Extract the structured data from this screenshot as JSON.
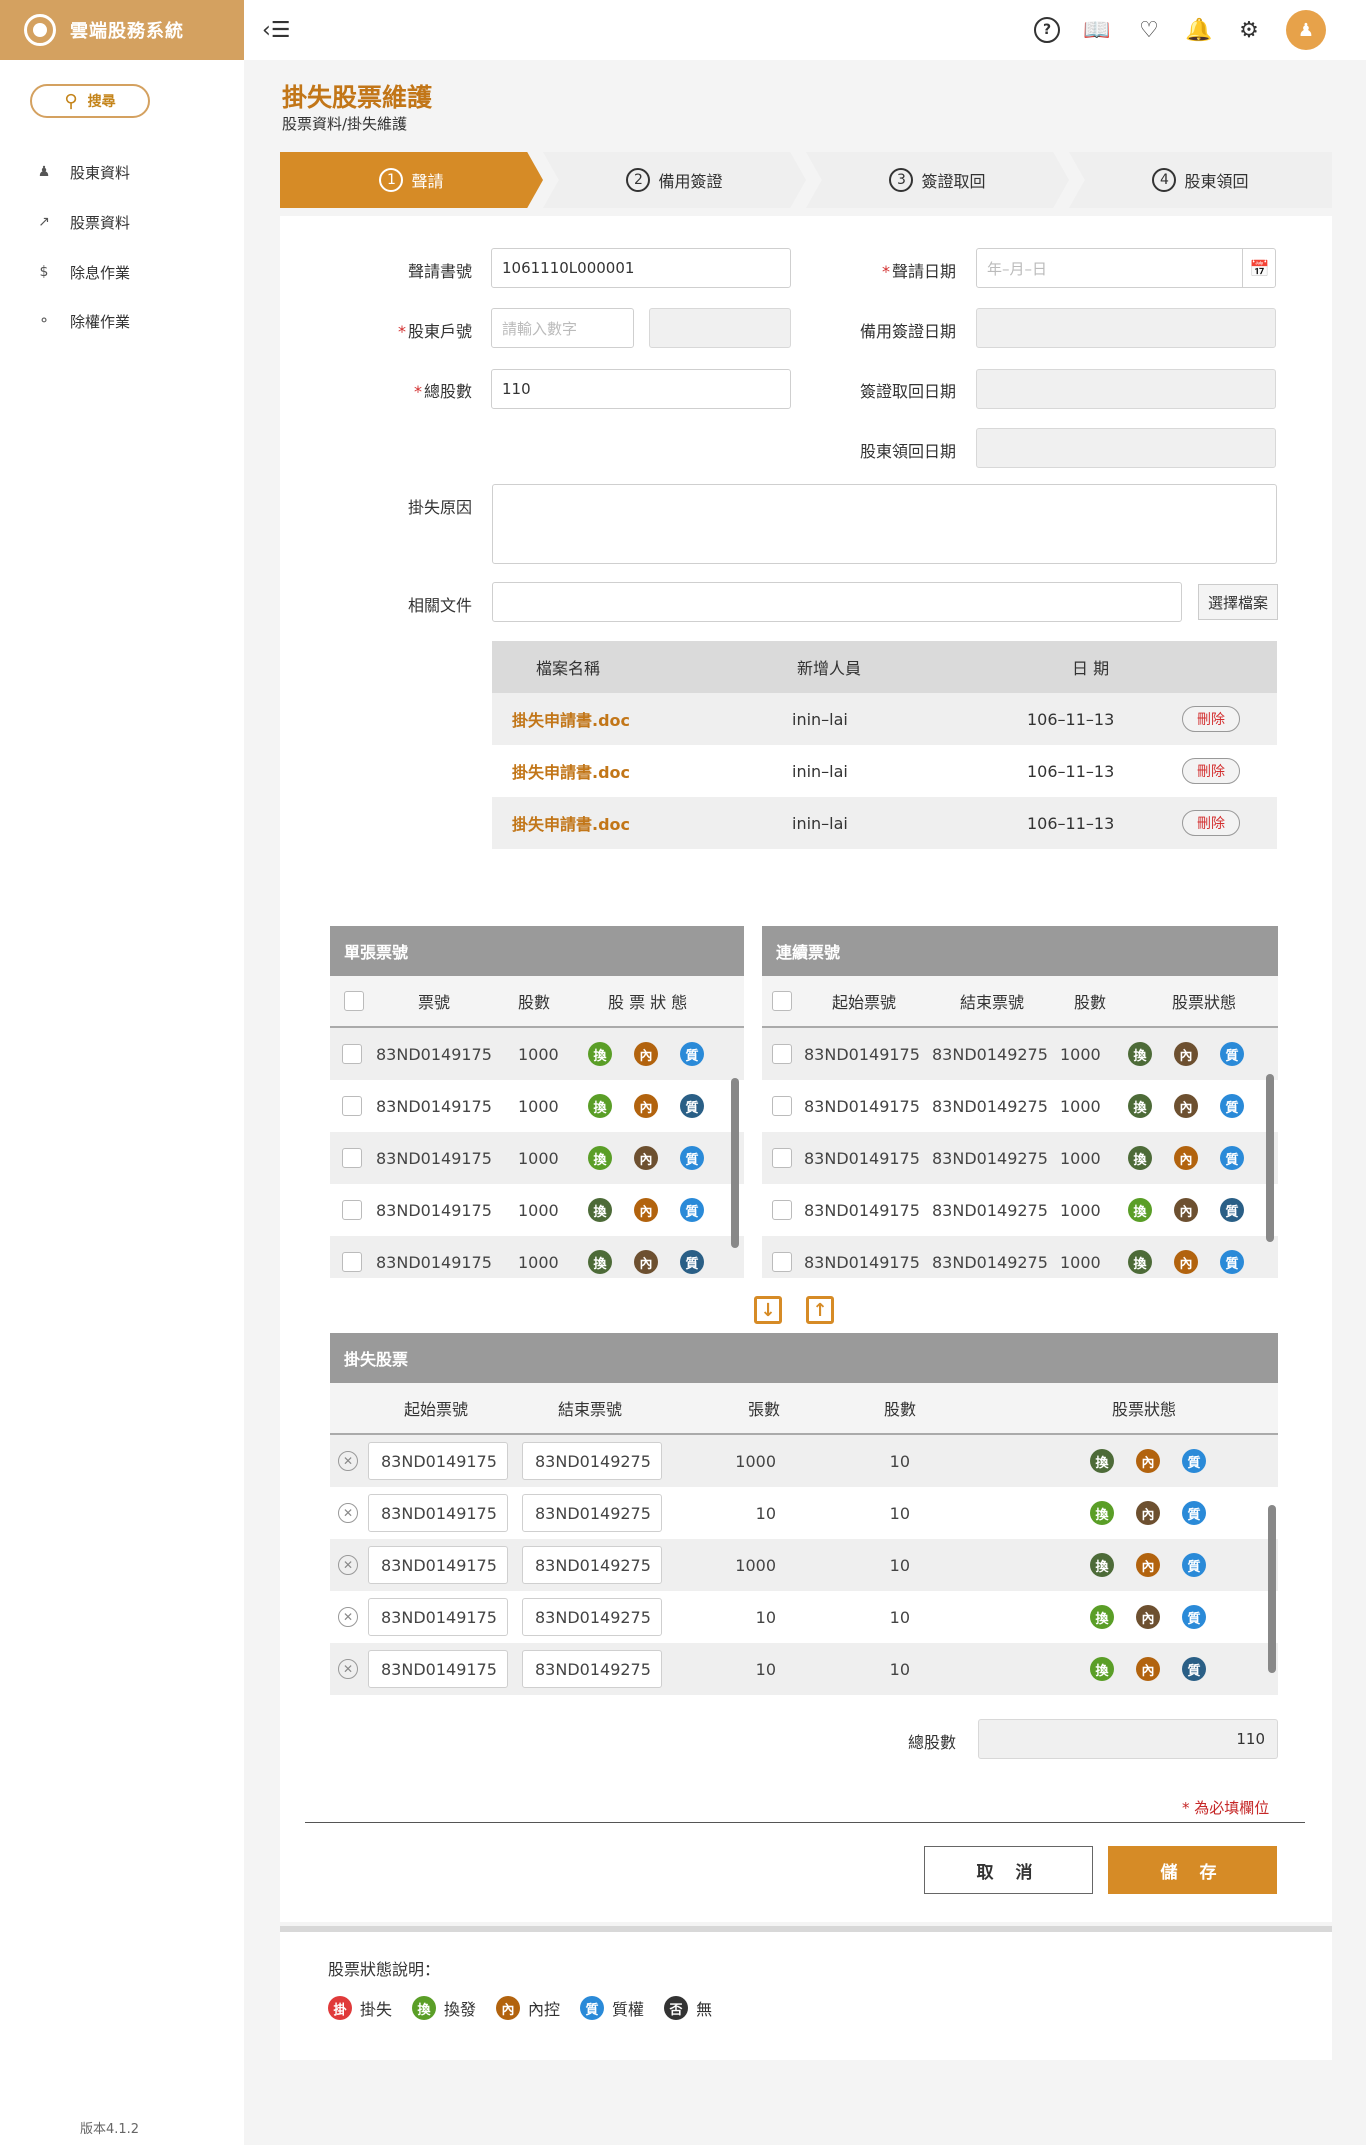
{
  "app": {
    "title": "雲端股務系統",
    "version": "版本4.1.2"
  },
  "sidebar": {
    "search_label": "搜尋",
    "items": [
      {
        "label": "股東資料"
      },
      {
        "label": "股票資料"
      },
      {
        "label": "除息作業"
      },
      {
        "label": "除權作業"
      }
    ]
  },
  "topbar": {
    "icons": [
      "help-icon",
      "book-icon",
      "heart-icon",
      "bell-icon",
      "gear-icon",
      "user-icon"
    ]
  },
  "page": {
    "title": "掛失股票維護",
    "breadcrumb": "股票資料/掛失維護"
  },
  "steps": [
    {
      "num": "1",
      "label": "聲請"
    },
    {
      "num": "2",
      "label": "備用簽證"
    },
    {
      "num": "3",
      "label": "簽證取回"
    },
    {
      "num": "4",
      "label": "股東領回"
    }
  ],
  "form": {
    "req_mark": "*",
    "application_no_label": "聲請書號",
    "application_no_value": "1061110L000001",
    "application_date_label": "聲請日期",
    "application_date_placeholder": "年–月–日",
    "shareholder_no_label": "股東戶號",
    "shareholder_no_placeholder": "請輸入數字",
    "backup_sign_date_label": "備用簽證日期",
    "total_shares_label": "總股數",
    "total_shares_value": "110",
    "sign_return_date_label": "簽證取回日期",
    "holder_return_date_label": "股東領回日期",
    "reason_label": "掛失原因",
    "docs_label": "相關文件",
    "choose_file_label": "選擇檔案"
  },
  "files": {
    "headers": [
      "檔案名稱",
      "新增人員",
      "日 期"
    ],
    "rows": [
      {
        "name": "掛失申請書.doc",
        "user": "inin–lai",
        "date": "106–11–13",
        "action": "刪除"
      },
      {
        "name": "掛失申請書.doc",
        "user": "inin–lai",
        "date": "106–11–13",
        "action": "刪除"
      },
      {
        "name": "掛失申請書.doc",
        "user": "inin–lai",
        "date": "106–11–13",
        "action": "刪除"
      }
    ]
  },
  "single": {
    "title": "單張票號",
    "headers": [
      "票號",
      "股數",
      "股 票 狀 態"
    ],
    "rows": [
      {
        "no": "83ND0149175",
        "shares": "1000",
        "badges": [
          "換",
          "內",
          "質"
        ],
        "styles": [
          "b-green",
          "b-brown",
          "b-blue"
        ]
      },
      {
        "no": "83ND0149175",
        "shares": "1000",
        "badges": [
          "換",
          "內",
          "質"
        ],
        "styles": [
          "b-green",
          "b-brown",
          "b-dblue"
        ]
      },
      {
        "no": "83ND0149175",
        "shares": "1000",
        "badges": [
          "換",
          "內",
          "質"
        ],
        "styles": [
          "b-green",
          "b-dbrown",
          "b-blue"
        ]
      },
      {
        "no": "83ND0149175",
        "shares": "1000",
        "badges": [
          "換",
          "內",
          "質"
        ],
        "styles": [
          "b-dgreen",
          "b-brown",
          "b-blue"
        ]
      },
      {
        "no": "83ND0149175",
        "shares": "1000",
        "badges": [
          "換",
          "內",
          "質"
        ],
        "styles": [
          "b-dgreen",
          "b-dbrown",
          "b-dblue"
        ]
      }
    ]
  },
  "consecutive": {
    "title": "連續票號",
    "headers": [
      "起始票號",
      "結束票號",
      "股數",
      "股票狀態"
    ],
    "rows": [
      {
        "start": "83ND0149175",
        "end": "83ND0149275",
        "shares": "1000",
        "badges": [
          "換",
          "內",
          "質"
        ],
        "styles": [
          "b-dgreen",
          "b-dbrown",
          "b-blue"
        ]
      },
      {
        "start": "83ND0149175",
        "end": "83ND0149275",
        "shares": "1000",
        "badges": [
          "換",
          "內",
          "質"
        ],
        "styles": [
          "b-dgreen",
          "b-dbrown",
          "b-blue"
        ]
      },
      {
        "start": "83ND0149175",
        "end": "83ND0149275",
        "shares": "1000",
        "badges": [
          "換",
          "內",
          "質"
        ],
        "styles": [
          "b-dgreen",
          "b-brown",
          "b-blue"
        ]
      },
      {
        "start": "83ND0149175",
        "end": "83ND0149275",
        "shares": "1000",
        "badges": [
          "換",
          "內",
          "質"
        ],
        "styles": [
          "b-green",
          "b-dbrown",
          "b-dblue"
        ]
      },
      {
        "start": "83ND0149175",
        "end": "83ND0149275",
        "shares": "1000",
        "badges": [
          "換",
          "內",
          "質"
        ],
        "styles": [
          "b-dgreen",
          "b-brown",
          "b-blue"
        ]
      }
    ]
  },
  "lost": {
    "title": "掛失股票",
    "headers": [
      "起始票號",
      "結束票號",
      "張數",
      "股數",
      "股票狀態"
    ],
    "rows": [
      {
        "start": "83ND0149175",
        "end": "83ND0149275",
        "sheets": "1000",
        "shares": "10",
        "badges": [
          "換",
          "內",
          "質"
        ],
        "styles": [
          "b-dgreen",
          "b-brown",
          "b-blue"
        ]
      },
      {
        "start": "83ND0149175",
        "end": "83ND0149275",
        "sheets": "10",
        "shares": "10",
        "badges": [
          "換",
          "內",
          "質"
        ],
        "styles": [
          "b-green",
          "b-dbrown",
          "b-blue"
        ]
      },
      {
        "start": "83ND0149175",
        "end": "83ND0149275",
        "sheets": "1000",
        "shares": "10",
        "badges": [
          "換",
          "內",
          "質"
        ],
        "styles": [
          "b-dgreen",
          "b-brown",
          "b-blue"
        ]
      },
      {
        "start": "83ND0149175",
        "end": "83ND0149275",
        "sheets": "10",
        "shares": "10",
        "badges": [
          "換",
          "內",
          "質"
        ],
        "styles": [
          "b-green",
          "b-dbrown",
          "b-blue"
        ]
      },
      {
        "start": "83ND0149175",
        "end": "83ND0149275",
        "sheets": "10",
        "shares": "10",
        "badges": [
          "換",
          "內",
          "質"
        ],
        "styles": [
          "b-green",
          "b-brown",
          "b-dblue"
        ]
      }
    ],
    "total_label": "總股數",
    "total_value": "110"
  },
  "required_note": "為必填欄位",
  "actions": {
    "cancel": "取 消",
    "save": "儲 存"
  },
  "legend": {
    "title": "股票狀態說明：",
    "items": [
      {
        "glyph": "掛",
        "label": "掛失",
        "style": "b-red"
      },
      {
        "glyph": "換",
        "label": "換發",
        "style": "b-green"
      },
      {
        "glyph": "內",
        "label": "內控",
        "style": "b-brown"
      },
      {
        "glyph": "質",
        "label": "質權",
        "style": "b-blue"
      },
      {
        "glyph": "否",
        "label": "無",
        "style": "b-black"
      }
    ]
  }
}
